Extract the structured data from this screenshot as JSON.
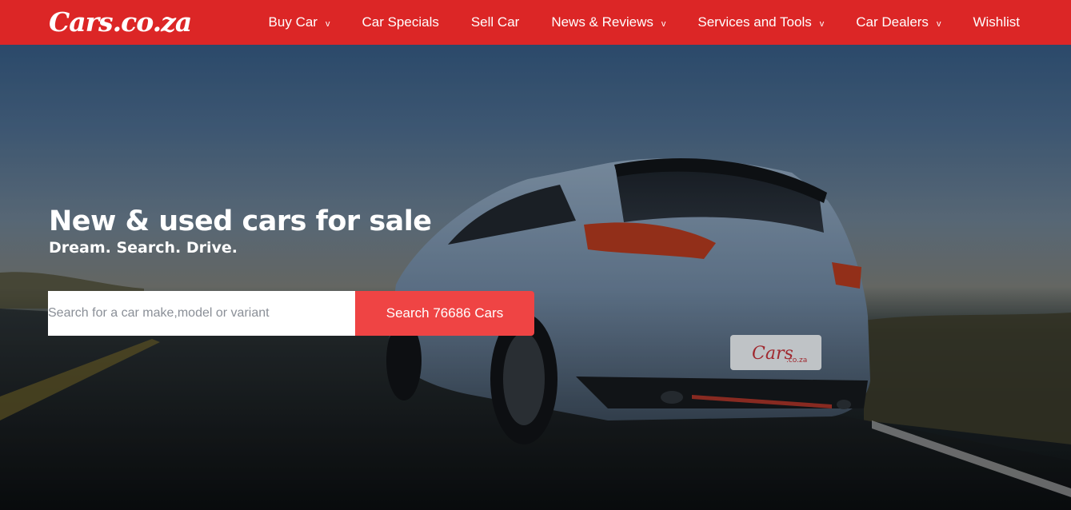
{
  "brand": {
    "logo_text": "Cars.co.za",
    "accent_color": "#dc2626",
    "button_color": "#ef4444"
  },
  "nav": {
    "items": [
      {
        "label": "Buy Car",
        "has_dropdown": true,
        "chevron": "v"
      },
      {
        "label": "Car Specials",
        "has_dropdown": false
      },
      {
        "label": "Sell Car",
        "has_dropdown": false
      },
      {
        "label": "News & Reviews",
        "has_dropdown": true,
        "chevron": "v"
      },
      {
        "label": "Services and Tools",
        "has_dropdown": true,
        "chevron": "v"
      },
      {
        "label": "Car Dealers",
        "has_dropdown": true,
        "chevron": "v"
      },
      {
        "label": "Wishlist",
        "has_dropdown": false
      }
    ]
  },
  "hero": {
    "headline": "New & used cars for sale",
    "subline": "Dream. Search. Drive.",
    "search_placeholder": "Search for a car make,model or variant",
    "search_button": "Search 76686 Cars",
    "number_plate_text": "Cars",
    "number_plate_subtext": ".co.za"
  }
}
